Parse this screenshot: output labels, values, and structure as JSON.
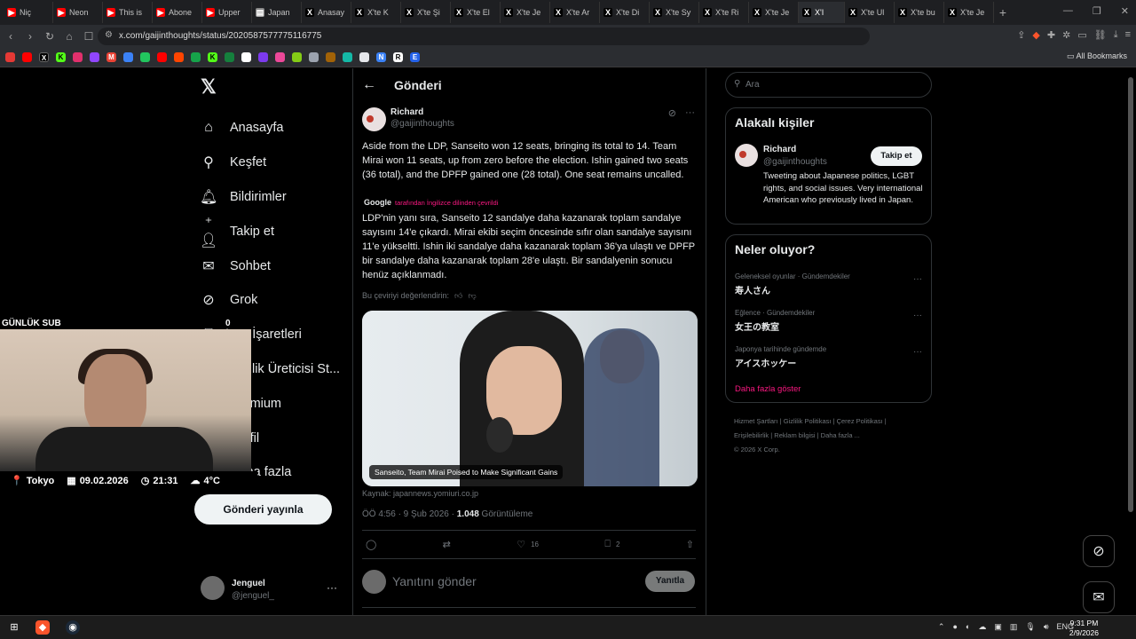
{
  "browser": {
    "tabs": [
      {
        "label": "Niç",
        "icon": "youtube-icon",
        "color": "#ff0000"
      },
      {
        "label": "Neon",
        "icon": "youtube-icon",
        "color": "#ff0000"
      },
      {
        "label": "This is",
        "icon": "youtube-icon",
        "color": "#ff0000"
      },
      {
        "label": "Abone",
        "icon": "youtube-icon",
        "color": "#ff0000"
      },
      {
        "label": "Upper",
        "icon": "youtube-icon",
        "color": "#ff0000"
      },
      {
        "label": "Japan",
        "icon": "page-icon",
        "color": "#888888"
      },
      {
        "label": "Anasay",
        "icon": "x-icon",
        "color": "#000000"
      },
      {
        "label": "X'te K",
        "icon": "x-icon",
        "color": "#000000"
      },
      {
        "label": "X'te Şi",
        "icon": "x-icon",
        "color": "#000000"
      },
      {
        "label": "X'te El",
        "icon": "x-icon",
        "color": "#000000"
      },
      {
        "label": "X'te Je",
        "icon": "x-icon",
        "color": "#000000"
      },
      {
        "label": "X'te Ar",
        "icon": "x-icon",
        "color": "#000000"
      },
      {
        "label": "X'te Di",
        "icon": "x-icon",
        "color": "#000000"
      },
      {
        "label": "X'te Sy",
        "icon": "x-icon",
        "color": "#000000"
      },
      {
        "label": "X'te Ri",
        "icon": "x-icon",
        "color": "#000000"
      },
      {
        "label": "X'te Je",
        "icon": "x-icon",
        "color": "#000000"
      },
      {
        "label": "X'I",
        "icon": "x-icon",
        "color": "#000000"
      },
      {
        "label": "X'te Ul",
        "icon": "x-icon",
        "color": "#000000"
      },
      {
        "label": "X'te bu",
        "icon": "x-icon",
        "color": "#000000"
      },
      {
        "label": "X'te Je",
        "icon": "x-icon",
        "color": "#000000"
      }
    ],
    "active_tab_index": 16,
    "url": "x.com/gaijinthoughts/status/2020587577775116775",
    "all_bookmarks": "All Bookmarks"
  },
  "nav": {
    "items": [
      {
        "label": "Anasayfa",
        "icon": "home-icon"
      },
      {
        "label": "Keşfet",
        "icon": "search-icon"
      },
      {
        "label": "Bildirimler",
        "icon": "bell-icon"
      },
      {
        "label": "Takip et",
        "icon": "add-person-icon"
      },
      {
        "label": "Sohbet",
        "icon": "mail-icon"
      },
      {
        "label": "Grok",
        "icon": "grok-icon"
      },
      {
        "label": "Yer İşaretleri",
        "icon": "bookmark-icon"
      },
      {
        "label": "Kimlik Üreticisi St...",
        "icon": "id-icon"
      },
      {
        "label": "Premium",
        "icon": "x-icon"
      },
      {
        "label": "Profil",
        "icon": "profile-icon"
      },
      {
        "label": "Daha fazla",
        "icon": "more-icon"
      }
    ],
    "post_button": "Gönderi yayınla",
    "account_name": "Jenguel",
    "account_handle": "@jenguel_"
  },
  "overlay": {
    "sub_label": "GÜNLÜK SUB",
    "counter": "0 / 5",
    "city": "Tokyo",
    "date": "09.02.2026",
    "time": "21:31",
    "temp": "4°C"
  },
  "main": {
    "header": "Gönderi",
    "author_name": "Richard",
    "author_handle": "@gaijinthoughts",
    "text": "Aside from the LDP, Sanseito won 12 seats, bringing its total to 14. Team Mirai won 11 seats, up from zero before the election. Ishin gained two seats (36 total), and the DPFP gained one (28 total). One seat remains uncalled.",
    "translated_by": "Google",
    "translated_note": "tarafından İngilizce dilinden çevrildi",
    "translation": "LDP'nin yanı sıra, Sanseito 12 sandalye daha kazanarak toplam sandalye sayısını 14'e çıkardı. Mirai ekibi seçim öncesinde sıfır olan sandalye sayısını 11'e yükseltti. Ishin iki sandalye daha kazanarak toplam 36'ya ulaştı ve DPFP bir sandalye daha kazanarak toplam 28'e ulaştı. Bir sandalyenin sonucu henüz açıklanmadı.",
    "rate_prompt": "Bu çeviriyi değerlendirin:",
    "card_caption": "Sanseito, Team Mirai Poised to Make Significant Gains",
    "source": "Kaynak: japannews.yomiuri.co.jp",
    "timestamp": "ÖÖ 4:56 · 9 Şub 2026 ·",
    "views": "1.048",
    "views_label": "Görüntüleme",
    "likes": "16",
    "bookmarks": "2",
    "reply_placeholder": "Yanıtını gönder",
    "reply_button": "Yanıtla"
  },
  "right": {
    "search_placeholder": "Ara",
    "related_title": "Alakalı kişiler",
    "person_name": "Richard",
    "person_handle": "@gaijinthoughts",
    "person_bio": "Tweeting about Japanese politics, LGBT rights, and social issues. Very international American who previously lived in Japan.",
    "follow_label": "Takip et",
    "trends_title": "Neler oluyor?",
    "trends": [
      {
        "category": "Geleneksel oyunlar · Gündemdekiler",
        "topic": "寿人さん"
      },
      {
        "category": "Eğlence · Gündemdekiler",
        "topic": "女王の教室"
      },
      {
        "category": "Japonya tarihinde gündemde",
        "topic": "アイスホッケー"
      }
    ],
    "show_more": "Daha fazla göster",
    "footer_line1": "Hizmet Şartları  |  Gizlilik Politikası  |  Çerez Politikası  |",
    "footer_line2": "Erişilebilirlik  |  Reklam bilgisi  |  Daha fazla ...",
    "footer_line3": "© 2026 X Corp."
  },
  "taskbar": {
    "lang": "ENG",
    "time": "9:31 PM",
    "date": "2/9/2026"
  }
}
